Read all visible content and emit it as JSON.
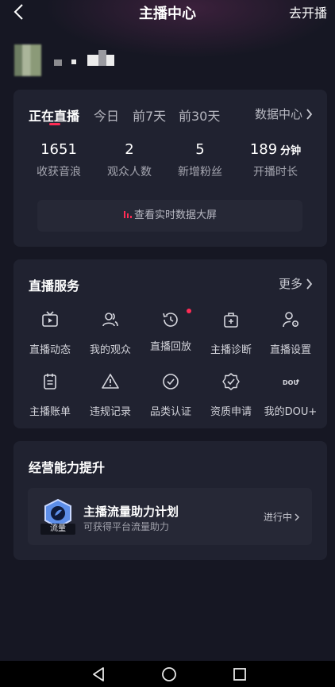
{
  "header": {
    "title": "主播中心",
    "go_live": "去开播"
  },
  "live": {
    "tabs": [
      "正在直播",
      "今日",
      "前7天",
      "前30天"
    ],
    "data_center": "数据中心",
    "stats": [
      {
        "value": "1651",
        "unit": "",
        "label": "收获音浪"
      },
      {
        "value": "2",
        "unit": "",
        "label": "观众人数"
      },
      {
        "value": "5",
        "unit": "",
        "label": "新增粉丝"
      },
      {
        "value": "189",
        "unit": "分钟",
        "label": "开播时长"
      }
    ],
    "realtime": "查看实时数据大屏"
  },
  "services": {
    "title": "直播服务",
    "more": "更多",
    "items": [
      {
        "label": "直播动态",
        "icon": "tv-icon"
      },
      {
        "label": "我的观众",
        "icon": "audience-icon"
      },
      {
        "label": "直播回放",
        "icon": "replay-icon"
      },
      {
        "label": "主播诊断",
        "icon": "medkit-icon"
      },
      {
        "label": "直播设置",
        "icon": "user-settings-icon"
      },
      {
        "label": "主播账单",
        "icon": "bill-icon"
      },
      {
        "label": "违规记录",
        "icon": "warning-icon"
      },
      {
        "label": "品类认证",
        "icon": "check-circle-icon"
      },
      {
        "label": "资质申请",
        "icon": "badge-check-icon"
      },
      {
        "label": "我的DOU+",
        "icon": "dou-icon"
      }
    ]
  },
  "growth": {
    "title": "经营能力提升",
    "plan_title": "主播流量助力计划",
    "plan_sub": "可获得平台流量助力",
    "plan_status": "进行中",
    "plan_badge": "流量"
  },
  "colors": {
    "background": "#161723",
    "card": "#202230",
    "accent": "#ff2c55"
  }
}
